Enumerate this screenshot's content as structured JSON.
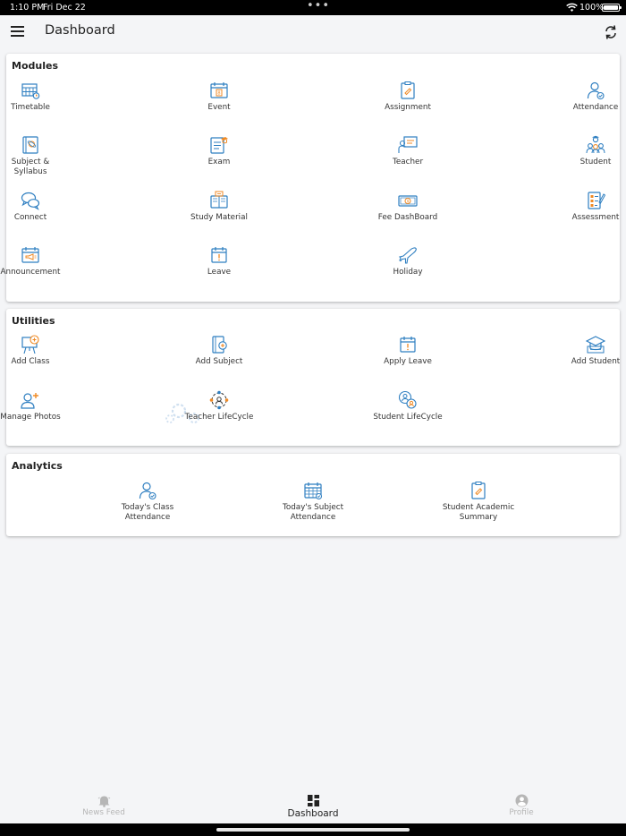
{
  "status": {
    "time": "1:10 PM",
    "date": "Fri Dec 22",
    "battery": "100%"
  },
  "header": {
    "title": "Dashboard"
  },
  "modules": {
    "title": "Modules",
    "items": [
      {
        "label": "Timetable",
        "icon": "timetable-icon"
      },
      {
        "label": "Event",
        "icon": "event-calendar-icon"
      },
      {
        "label": "Assignment",
        "icon": "assignment-clipboard-icon"
      },
      {
        "label": "Attendance",
        "icon": "attendance-user-check-icon"
      },
      {
        "label": "Subject & Syllabus",
        "icon": "subject-book-icon"
      },
      {
        "label": "Exam",
        "icon": "exam-sheet-icon"
      },
      {
        "label": "Teacher",
        "icon": "teacher-board-icon"
      },
      {
        "label": "Student",
        "icon": "student-group-icon"
      },
      {
        "label": "Connect",
        "icon": "connect-chat-icon"
      },
      {
        "label": "Study Material",
        "icon": "study-material-icon"
      },
      {
        "label": "Fee DashBoard",
        "icon": "fee-cash-icon"
      },
      {
        "label": "Assessment",
        "icon": "assessment-checklist-icon"
      },
      {
        "label": "Announcement",
        "icon": "announcement-megaphone-icon"
      },
      {
        "label": "Leave",
        "icon": "leave-calendar-icon"
      },
      {
        "label": "Holiday",
        "icon": "holiday-plane-icon"
      }
    ]
  },
  "utilities": {
    "title": "Utilities",
    "items": [
      {
        "label": "Add Class",
        "icon": "add-class-board-icon"
      },
      {
        "label": "Add Subject",
        "icon": "add-subject-icon"
      },
      {
        "label": "Apply Leave",
        "icon": "apply-leave-icon"
      },
      {
        "label": "Add Student",
        "icon": "add-student-cap-icon"
      },
      {
        "label": "Manage Photos",
        "icon": "manage-photos-user-add-icon"
      },
      {
        "label": "Teacher LifeCycle",
        "icon": "teacher-lifecycle-icon"
      },
      {
        "label": "Student LifeCycle",
        "icon": "student-lifecycle-icon"
      }
    ]
  },
  "analytics": {
    "title": "Analytics",
    "items": [
      {
        "label": "Today's Class Attendance",
        "icon": "class-attendance-icon"
      },
      {
        "label": "Today's Subject Attendance",
        "icon": "subject-attendance-calendar-icon"
      },
      {
        "label": "Student Academic Summary",
        "icon": "academic-summary-clipboard-icon"
      }
    ]
  },
  "bottom_nav": {
    "items": [
      {
        "label": "News Feed",
        "icon": "bell-icon"
      },
      {
        "label": "Dashboard",
        "icon": "dashboard-grid-icon"
      },
      {
        "label": "Profile",
        "icon": "profile-user-icon"
      }
    ]
  },
  "colors": {
    "icon_blue": "#2f7fc1",
    "icon_orange": "#f08a24",
    "card_bg": "#ffffff",
    "page_bg": "#f4f5f7"
  }
}
